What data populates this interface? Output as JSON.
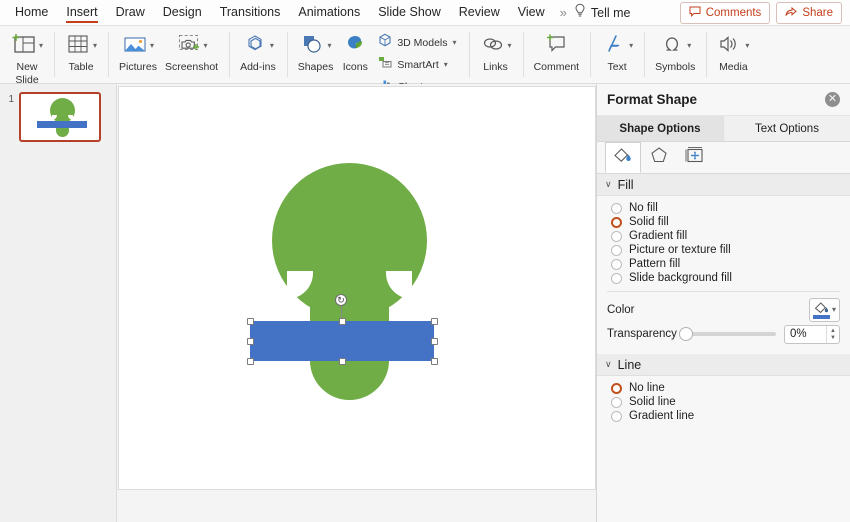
{
  "menubar": {
    "items": [
      {
        "label": "Home",
        "active": false
      },
      {
        "label": "Insert",
        "active": true
      },
      {
        "label": "Draw",
        "active": false
      },
      {
        "label": "Design",
        "active": false
      },
      {
        "label": "Transitions",
        "active": false
      },
      {
        "label": "Animations",
        "active": false
      },
      {
        "label": "Slide Show",
        "active": false
      },
      {
        "label": "Review",
        "active": false
      },
      {
        "label": "View",
        "active": false
      }
    ],
    "overflow": "»",
    "tell_me": "Tell me",
    "comments_label": "Comments",
    "share_label": "Share",
    "accent_color": "#c43e1c"
  },
  "ribbon": {
    "groups": [
      {
        "buttons": [
          {
            "label_line1": "New",
            "label_line2": "Slide",
            "icon": "new-slide-icon",
            "has_caret": true
          }
        ]
      },
      {
        "buttons": [
          {
            "label_line1": "Table",
            "label_line2": "",
            "icon": "table-icon",
            "has_caret": true
          }
        ]
      },
      {
        "buttons": [
          {
            "label_line1": "Pictures",
            "label_line2": "",
            "icon": "pictures-icon",
            "has_caret": true
          },
          {
            "label_line1": "Screenshot",
            "label_line2": "",
            "icon": "screenshot-icon",
            "has_caret": true
          }
        ]
      },
      {
        "buttons": [
          {
            "label_line1": "Add-ins",
            "label_line2": "",
            "icon": "add-ins-icon",
            "has_caret": true
          }
        ]
      },
      {
        "buttons": [
          {
            "label_line1": "Shapes",
            "label_line2": "",
            "icon": "shapes-icon",
            "has_caret": true
          },
          {
            "label_line1": "Icons",
            "label_line2": "",
            "icon": "icons-icon",
            "has_caret": false
          }
        ],
        "stack": [
          {
            "label": "3D Models",
            "icon": "cube-icon",
            "has_caret": true
          },
          {
            "label": "SmartArt",
            "icon": "smartart-icon",
            "has_caret": true
          },
          {
            "label": "Chart",
            "icon": "chart-icon",
            "has_caret": true
          }
        ]
      },
      {
        "buttons": [
          {
            "label_line1": "Links",
            "label_line2": "",
            "icon": "links-icon",
            "has_caret": true
          }
        ]
      },
      {
        "buttons": [
          {
            "label_line1": "Comment",
            "label_line2": "",
            "icon": "comment-icon",
            "has_caret": false
          }
        ]
      },
      {
        "buttons": [
          {
            "label_line1": "Text",
            "label_line2": "",
            "icon": "text-icon",
            "has_caret": true
          }
        ]
      },
      {
        "buttons": [
          {
            "label_line1": "Symbols",
            "label_line2": "",
            "icon": "symbols-icon",
            "has_caret": true
          }
        ]
      },
      {
        "buttons": [
          {
            "label_line1": "Media",
            "label_line2": "",
            "icon": "media-icon",
            "has_caret": true
          }
        ]
      }
    ]
  },
  "thumbnails": {
    "slides": [
      {
        "number": "1",
        "selected": true
      }
    ]
  },
  "canvas": {
    "bulb_color": "#70ad47",
    "rect_color": "#4472c4",
    "rotation_handle_glyph": "↻"
  },
  "format_pane": {
    "title": "Format Shape",
    "close_glyph": "✕",
    "tabs": [
      {
        "label": "Shape Options",
        "selected": true
      },
      {
        "label": "Text Options",
        "selected": false
      }
    ],
    "icon_tabs": [
      {
        "name": "fill-and-line-icon",
        "selected": true
      },
      {
        "name": "effects-icon",
        "selected": false
      },
      {
        "name": "size-and-properties-icon",
        "selected": false
      }
    ],
    "fill_section": {
      "title": "Fill",
      "chevron": "∨",
      "options": [
        {
          "label": "No fill",
          "selected": false
        },
        {
          "label": "Solid fill",
          "selected": true
        },
        {
          "label": "Gradient fill",
          "selected": false
        },
        {
          "label": "Picture or texture fill",
          "selected": false
        },
        {
          "label": "Pattern fill",
          "selected": false
        },
        {
          "label": "Slide background fill",
          "selected": false
        }
      ],
      "color_label": "Color",
      "color_value": "#4472c4",
      "transparency_label": "Transparency",
      "transparency_value": "0%"
    },
    "line_section": {
      "title": "Line",
      "chevron": "∨",
      "options": [
        {
          "label": "No line",
          "selected": true
        },
        {
          "label": "Solid line",
          "selected": false
        },
        {
          "label": "Gradient line",
          "selected": false
        }
      ]
    }
  }
}
